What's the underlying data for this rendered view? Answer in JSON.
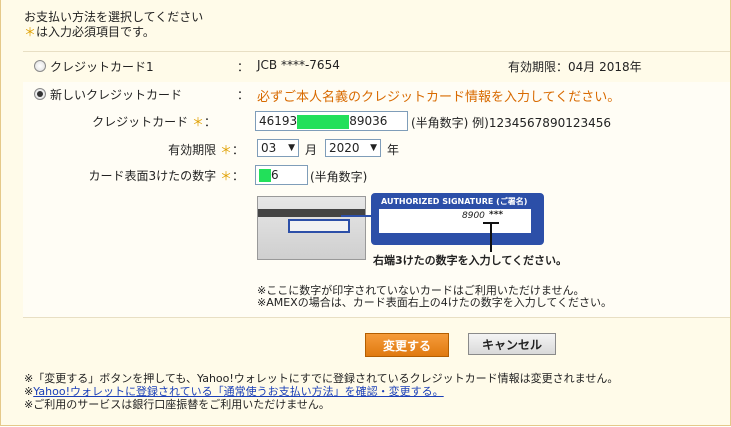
{
  "header": {
    "line1": "お支払い方法を選択してください",
    "star": "＊",
    "line2": "は入力必須項目です。"
  },
  "existing_card": {
    "label": "クレジットカード1",
    "colon": "：",
    "number": "JCB ****-7654",
    "expiry": "有効期限：04月 2018年"
  },
  "new_card": {
    "label": "新しいクレジットカード",
    "colon": "：",
    "notice": "必ずご本人名義のクレジットカード情報を入力してください。"
  },
  "form": {
    "card_number_label": "クレジットカード",
    "star": "＊",
    "colon": "：",
    "card_number_prefix": "46193",
    "card_number_suffix": "89036",
    "card_number_hint": "(半角数字) 例)1234567890123456",
    "expiry_label": "有効期限",
    "expiry_month": "03",
    "month_unit": "月",
    "expiry_year": "2020",
    "year_unit": "年",
    "cvv_label": "カード表面3けたの数字",
    "cvv_suffix": "6",
    "cvv_hint": "(半角数字)"
  },
  "illustration": {
    "sig_title": "AUTHORIZED SIGNATURE (ご署名)",
    "sig_number": "8900",
    "sig_mask": "***",
    "caption": "右端3けたの数字を入力してください。"
  },
  "card_notes": [
    "※ここに数字が印字されていないカードはご利用いただけません。",
    "※AMEXの場合は、カード表面右上の4けたの数字を入力してください。"
  ],
  "buttons": {
    "change": "変更する",
    "cancel": "キャンセル"
  },
  "footer": {
    "note1": "※「変更する」ボタンを押しても、Yahoo!ウォレットにすでに登録されているクレジットカード情報は変更されません。",
    "note2_prefix": "※",
    "note2_link": "Yahoo!ウォレットに登録されている「通常使うお支払い方法」を確認・変更する。",
    "note3": "※ご利用のサービスは銀行口座振替をご利用いただけません。"
  },
  "colors": {
    "accent_orange": "#d86a00",
    "button_orange": "#e07a10",
    "signature_blue": "#2c4fa8",
    "masked_green": "#22e05a"
  }
}
